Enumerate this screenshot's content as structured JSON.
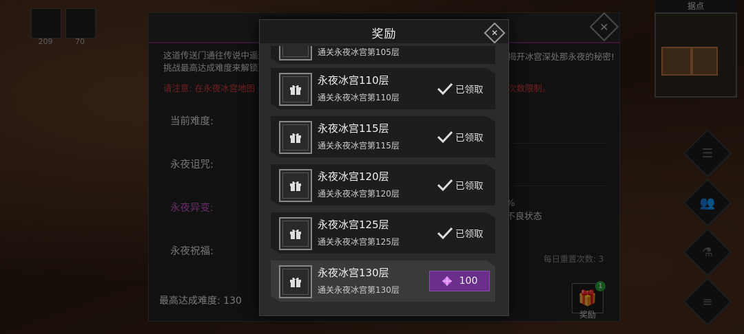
{
  "hud": {
    "slot1_count": "209",
    "slot2_count": "70"
  },
  "minimap": {
    "title": "据点"
  },
  "portal": {
    "desc_line1": "这道传送门通往传说中遥远",
    "desc_line2": "挑战最高达成难度来解锁更",
    "desc_right": "揭开冰宫深处那永夜的秘密!",
    "warn_left": "请注意: 在永夜冰宫地图",
    "warn_right": "次数限制。",
    "labels": {
      "difficulty": "当前难度:",
      "curse": "永夜诅咒:",
      "mutation": "永夜异变:",
      "blessing": "永夜祝福:"
    },
    "right_text1": "%",
    "right_text2": "不良状态",
    "reset": "每日重置次数: 3",
    "max": "最高达成难度: 130",
    "gift_label": "奖励",
    "badge": "1"
  },
  "modal": {
    "title": "奖励",
    "partial_sub": "通关永夜冰宫第105层",
    "items": [
      {
        "title": "永夜冰宫110层",
        "sub": "通关永夜冰宫第110层",
        "status": "已领取"
      },
      {
        "title": "永夜冰宫115层",
        "sub": "通关永夜冰宫第115层",
        "status": "已领取"
      },
      {
        "title": "永夜冰宫120层",
        "sub": "通关永夜冰宫第120层",
        "status": "已领取"
      },
      {
        "title": "永夜冰宫125层",
        "sub": "通关永夜冰宫第125层",
        "status": "已领取"
      },
      {
        "title": "永夜冰宫130层",
        "sub": "通关永夜冰宫第130层",
        "reward": "100"
      }
    ]
  },
  "colors": {
    "claim_purple": "#6a2f8a",
    "warn_red": "#d23a3a",
    "mutation_purple": "#c050c0",
    "badge_green": "#2c9a3a"
  }
}
